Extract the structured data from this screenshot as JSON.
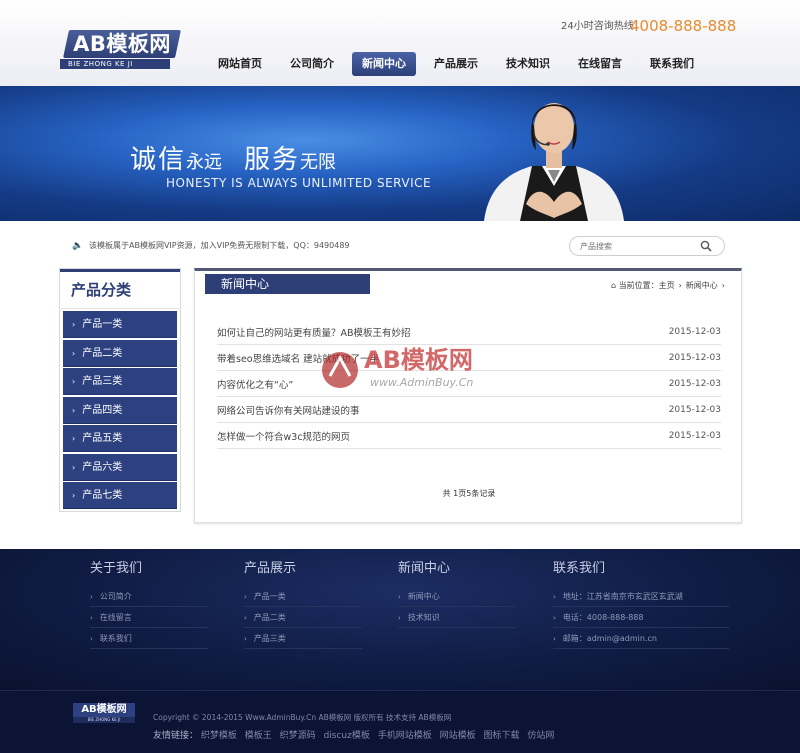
{
  "header": {
    "logo_main": "AB模板网",
    "logo_sub": "BIE ZHONG KE JI",
    "hotline_label": "24小时咨询热线：",
    "hotline_number": "4008-888-888",
    "nav": [
      "网站首页",
      "公司简介",
      "新闻中心",
      "产品展示",
      "技术知识",
      "在线留言",
      "联系我们"
    ],
    "nav_active": "新闻中心"
  },
  "banner": {
    "line1_big1": "诚信",
    "line1_small1": "永远",
    "line1_big2": "服务",
    "line1_small2": "无限",
    "line2": "HONESTY IS ALWAYS UNLIMITED SERVICE"
  },
  "notice": {
    "text": "该模板属于AB模板网VIP资源，加入VIP免费无限制下载，QQ：9490489"
  },
  "search": {
    "placeholder": "产品搜索"
  },
  "sidebar": {
    "title": "产品分类",
    "items": [
      "产品一类",
      "产品二类",
      "产品三类",
      "产品四类",
      "产品五类",
      "产品六类",
      "产品七类"
    ]
  },
  "main": {
    "title": "新闻中心",
    "crumb_label": "当前位置：",
    "crumb_home": "主页",
    "crumb_current": "新闻中心",
    "news": [
      {
        "title": "如何让自己的网站更有质量？AB模板王有妙招",
        "date": "2015-12-03"
      },
      {
        "title": "带着seo思维选域名 建站就成功了一半",
        "date": "2015-12-03"
      },
      {
        "title": "内容优化之有“心”",
        "date": "2015-12-03"
      },
      {
        "title": "网络公司告诉你有关网站建设的事",
        "date": "2015-12-03"
      },
      {
        "title": "怎样做一个符合w3c规范的网页",
        "date": "2015-12-03"
      }
    ],
    "pager": "共 1页5条记录"
  },
  "watermark": {
    "main": "AB模板网",
    "sub": "www.AdminBuy.Cn"
  },
  "footer": {
    "cols": [
      {
        "title": "关于我们",
        "items": [
          "公司简介",
          "在线留言",
          "联系我们"
        ]
      },
      {
        "title": "产品展示",
        "items": [
          "产品一类",
          "产品二类",
          "产品三类"
        ]
      },
      {
        "title": "新闻中心",
        "items": [
          "新闻中心",
          "技术知识"
        ]
      },
      {
        "title": "联系我们",
        "items": [
          "地址：江苏省南京市玄武区玄武湖",
          "电话：4008-888-888",
          "邮箱：admin@admin.cn"
        ]
      }
    ],
    "bottom_logo_main": "AB模板网",
    "bottom_logo_sub": "BIE ZHONG KE JI",
    "copyright": "Copyright © 2014-2015 Www.AdminBuy.Cn AB模板网 版权所有  技术支持 AB模板网",
    "links_label": "友情链接：",
    "links": [
      "织梦模板",
      "模板王",
      "织梦源码",
      "discuz模板",
      "手机网站模板",
      "网站模板",
      "图标下载",
      "仿站网"
    ]
  },
  "colors": {
    "brand_navy": "#2d3f76",
    "accent_orange": "#e98a2c",
    "banner_blue": "#2662c2",
    "footer_bg": "#101c44"
  }
}
